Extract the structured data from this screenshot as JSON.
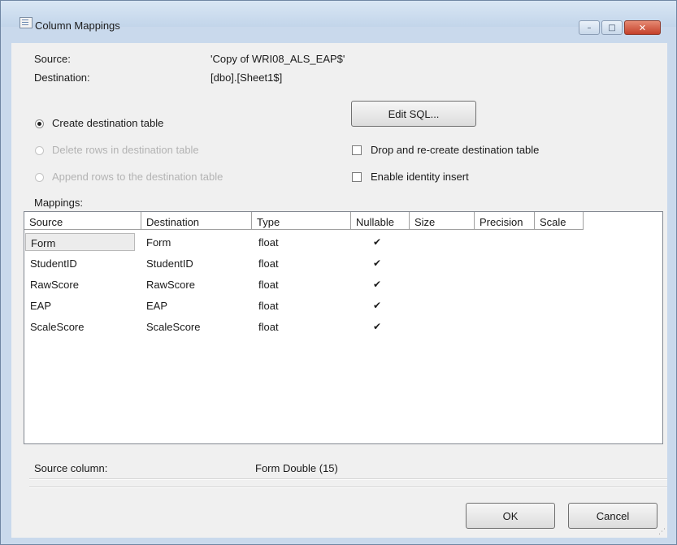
{
  "window": {
    "title": "Column Mappings",
    "minimize_glyph": "–",
    "maximize_glyph": "□",
    "close_glyph": "✕"
  },
  "source": {
    "label": "Source:",
    "value": "'Copy of WRI08_ALS_EAP$'"
  },
  "destination": {
    "label": "Destination:",
    "value": "[dbo].[Sheet1$]"
  },
  "options": {
    "create_table": {
      "label": "Create destination table",
      "checked": true,
      "enabled": true
    },
    "delete_rows": {
      "label": "Delete rows in destination table",
      "checked": false,
      "enabled": false
    },
    "append_rows": {
      "label": "Append rows to the destination table",
      "checked": false,
      "enabled": false
    }
  },
  "edit_sql_label": "Edit SQL...",
  "drop_recreate": {
    "label": "Drop and re-create destination table",
    "checked": false
  },
  "identity_insert": {
    "label": "Enable identity insert",
    "checked": false
  },
  "mappings_label": "Mappings:",
  "grid": {
    "columns": [
      "Source",
      "Destination",
      "Type",
      "Nullable",
      "Size",
      "Precision",
      "Scale"
    ],
    "rows": [
      {
        "source": "Form",
        "destination": "Form",
        "type": "float",
        "nullable": true,
        "size": "",
        "precision": "",
        "scale": ""
      },
      {
        "source": "StudentID",
        "destination": "StudentID",
        "type": "float",
        "nullable": true,
        "size": "",
        "precision": "",
        "scale": ""
      },
      {
        "source": "RawScore",
        "destination": "RawScore",
        "type": "float",
        "nullable": true,
        "size": "",
        "precision": "",
        "scale": ""
      },
      {
        "source": "EAP",
        "destination": "EAP",
        "type": "float",
        "nullable": true,
        "size": "",
        "precision": "",
        "scale": ""
      },
      {
        "source": "ScaleScore",
        "destination": "ScaleScore",
        "type": "float",
        "nullable": true,
        "size": "",
        "precision": "",
        "scale": ""
      }
    ],
    "check_glyph": "✔"
  },
  "source_column": {
    "label": "Source column:",
    "value": "Form Double (15)"
  },
  "ok_label": "OK",
  "cancel_label": "Cancel",
  "grip_glyph": "⋰"
}
